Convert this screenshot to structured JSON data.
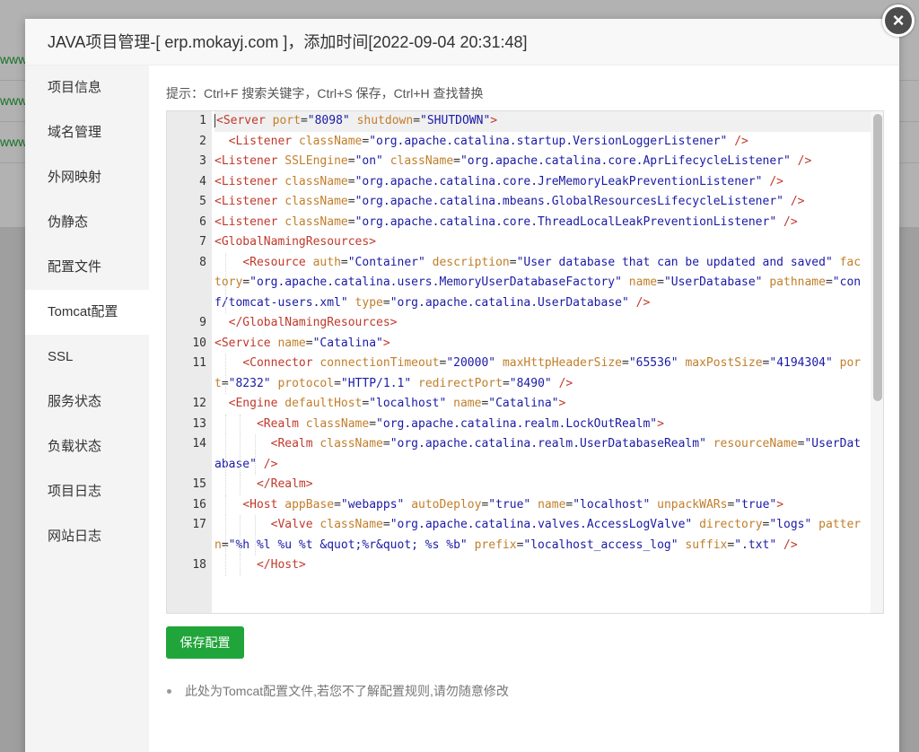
{
  "background": {
    "links": [
      "www",
      "www",
      "www"
    ]
  },
  "dialog": {
    "title": "JAVA项目管理-[ erp.mokayj.com ]，添加时间[2022-09-04 20:31:48]",
    "close_glyph": "×"
  },
  "sidebar": {
    "items": [
      {
        "label": "项目信息",
        "active": false
      },
      {
        "label": "域名管理",
        "active": false
      },
      {
        "label": "外网映射",
        "active": false
      },
      {
        "label": "伪静态",
        "active": false
      },
      {
        "label": "配置文件",
        "active": false
      },
      {
        "label": "Tomcat配置",
        "active": true
      },
      {
        "label": "SSL",
        "active": false
      },
      {
        "label": "服务状态",
        "active": false
      },
      {
        "label": "负载状态",
        "active": false
      },
      {
        "label": "项目日志",
        "active": false
      },
      {
        "label": "网站日志",
        "active": false
      }
    ]
  },
  "main": {
    "hint": "提示：Ctrl+F 搜索关键字，Ctrl+S 保存，Ctrl+H 查找替换",
    "save_label": "保存配置",
    "notes": [
      "此处为Tomcat配置文件,若您不了解配置规则,请勿随意修改"
    ]
  },
  "editor": {
    "active_line": 1,
    "lines": [
      {
        "n": "1",
        "indent": "",
        "guides": 0,
        "tokens": [
          [
            "tag",
            "<Server"
          ],
          [
            "t",
            " "
          ],
          [
            "attr",
            "port"
          ],
          [
            "t",
            "="
          ],
          [
            "val",
            "\"8098\""
          ],
          [
            "t",
            " "
          ],
          [
            "attr",
            "shutdown"
          ],
          [
            "t",
            "="
          ],
          [
            "val",
            "\"SHUTDOWN\""
          ],
          [
            "tag",
            ">"
          ]
        ]
      },
      {
        "n": "2",
        "indent": "  ",
        "guides": 0,
        "tokens": [
          [
            "tag",
            "<Listener"
          ],
          [
            "t",
            " "
          ],
          [
            "attr",
            "className"
          ],
          [
            "t",
            "="
          ],
          [
            "val",
            "\"org.apache.catalina.startup.VersionLoggerListener\""
          ],
          [
            "t",
            " "
          ],
          [
            "tag",
            "/>"
          ]
        ]
      },
      {
        "n": "3",
        "indent": "",
        "guides": 0,
        "tokens": [
          [
            "tag",
            "<Listener"
          ],
          [
            "t",
            " "
          ],
          [
            "attr",
            "SSLEngine"
          ],
          [
            "t",
            "="
          ],
          [
            "val",
            "\"on\""
          ],
          [
            "t",
            " "
          ],
          [
            "attr",
            "className"
          ],
          [
            "t",
            "="
          ],
          [
            "val",
            "\"org.apache.catalina.core.AprLifecycleListener\""
          ],
          [
            "t",
            " "
          ],
          [
            "tag",
            "/>"
          ]
        ]
      },
      {
        "n": "4",
        "indent": "",
        "guides": 0,
        "tokens": [
          [
            "tag",
            "<Listener"
          ],
          [
            "t",
            " "
          ],
          [
            "attr",
            "className"
          ],
          [
            "t",
            "="
          ],
          [
            "val",
            "\"org.apache.catalina.core.JreMemoryLeakPreventionListener\""
          ],
          [
            "t",
            " "
          ],
          [
            "tag",
            "/>"
          ]
        ]
      },
      {
        "n": "5",
        "indent": "",
        "guides": 0,
        "tokens": [
          [
            "tag",
            "<Listener"
          ],
          [
            "t",
            " "
          ],
          [
            "attr",
            "className"
          ],
          [
            "t",
            "="
          ],
          [
            "val",
            "\"org.apache.catalina.mbeans.GlobalResourcesLifecycleListener\""
          ],
          [
            "t",
            " "
          ],
          [
            "tag",
            "/>"
          ]
        ]
      },
      {
        "n": "6",
        "indent": "",
        "guides": 0,
        "tokens": [
          [
            "tag",
            "<Listener"
          ],
          [
            "t",
            " "
          ],
          [
            "attr",
            "className"
          ],
          [
            "t",
            "="
          ],
          [
            "val",
            "\"org.apache.catalina.core.ThreadLocalLeakPreventionListener\""
          ],
          [
            "t",
            " "
          ],
          [
            "tag",
            "/>"
          ]
        ]
      },
      {
        "n": "7",
        "indent": "",
        "guides": 0,
        "tokens": [
          [
            "tag",
            "<GlobalNamingResources>"
          ]
        ]
      },
      {
        "n": "8",
        "indent": "    ",
        "guides": 1,
        "tokens": [
          [
            "tag",
            "<Resource"
          ],
          [
            "t",
            " "
          ],
          [
            "attr",
            "auth"
          ],
          [
            "t",
            "="
          ],
          [
            "val",
            "\"Container\""
          ],
          [
            "t",
            " "
          ],
          [
            "attr",
            "description"
          ],
          [
            "t",
            "="
          ],
          [
            "val",
            "\"User database that can be updated and saved\""
          ],
          [
            "t",
            " "
          ],
          [
            "attr",
            "factory"
          ],
          [
            "t",
            "="
          ],
          [
            "val",
            "\"org.apache.catalina.users.MemoryUserDatabaseFactory\""
          ],
          [
            "t",
            " "
          ],
          [
            "attr",
            "name"
          ],
          [
            "t",
            "="
          ],
          [
            "val",
            "\"UserDatabase\""
          ],
          [
            "t",
            " "
          ],
          [
            "attr",
            "pathname"
          ],
          [
            "t",
            "="
          ],
          [
            "val",
            "\"conf/tomcat-users.xml\""
          ],
          [
            "t",
            " "
          ],
          [
            "attr",
            "type"
          ],
          [
            "t",
            "="
          ],
          [
            "val",
            "\"org.apache.catalina.UserDatabase\""
          ],
          [
            "t",
            " "
          ],
          [
            "tag",
            "/>"
          ]
        ]
      },
      {
        "n": "9",
        "indent": "  ",
        "guides": 0,
        "tokens": [
          [
            "tag",
            "</GlobalNamingResources>"
          ]
        ]
      },
      {
        "n": "10",
        "indent": "",
        "guides": 0,
        "tokens": [
          [
            "tag",
            "<Service"
          ],
          [
            "t",
            " "
          ],
          [
            "attr",
            "name"
          ],
          [
            "t",
            "="
          ],
          [
            "val",
            "\"Catalina\""
          ],
          [
            "tag",
            ">"
          ]
        ]
      },
      {
        "n": "11",
        "indent": "    ",
        "guides": 1,
        "tokens": [
          [
            "tag",
            "<Connector"
          ],
          [
            "t",
            " "
          ],
          [
            "attr",
            "connectionTimeout"
          ],
          [
            "t",
            "="
          ],
          [
            "val",
            "\"20000\""
          ],
          [
            "t",
            " "
          ],
          [
            "attr",
            "maxHttpHeaderSize"
          ],
          [
            "t",
            "="
          ],
          [
            "val",
            "\"65536\""
          ],
          [
            "t",
            " "
          ],
          [
            "attr",
            "maxPostSize"
          ],
          [
            "t",
            "="
          ],
          [
            "val",
            "\"4194304\""
          ],
          [
            "t",
            " "
          ],
          [
            "attr",
            "port"
          ],
          [
            "t",
            "="
          ],
          [
            "val",
            "\"8232\""
          ],
          [
            "t",
            " "
          ],
          [
            "attr",
            "protocol"
          ],
          [
            "t",
            "="
          ],
          [
            "val",
            "\"HTTP/1.1\""
          ],
          [
            "t",
            " "
          ],
          [
            "attr",
            "redirectPort"
          ],
          [
            "t",
            "="
          ],
          [
            "val",
            "\"8490\""
          ],
          [
            "t",
            " "
          ],
          [
            "tag",
            "/>"
          ]
        ]
      },
      {
        "n": "12",
        "indent": "  ",
        "guides": 0,
        "tokens": [
          [
            "tag",
            "<Engine"
          ],
          [
            "t",
            " "
          ],
          [
            "attr",
            "defaultHost"
          ],
          [
            "t",
            "="
          ],
          [
            "val",
            "\"localhost\""
          ],
          [
            "t",
            " "
          ],
          [
            "attr",
            "name"
          ],
          [
            "t",
            "="
          ],
          [
            "val",
            "\"Catalina\""
          ],
          [
            "tag",
            ">"
          ]
        ]
      },
      {
        "n": "13",
        "indent": "      ",
        "guides": 2,
        "tokens": [
          [
            "tag",
            "<Realm"
          ],
          [
            "t",
            " "
          ],
          [
            "attr",
            "className"
          ],
          [
            "t",
            "="
          ],
          [
            "val",
            "\"org.apache.catalina.realm.LockOutRealm\""
          ],
          [
            "tag",
            ">"
          ]
        ]
      },
      {
        "n": "14",
        "indent": "        ",
        "guides": 3,
        "tokens": [
          [
            "tag",
            "<Realm"
          ],
          [
            "t",
            " "
          ],
          [
            "attr",
            "className"
          ],
          [
            "t",
            "="
          ],
          [
            "val",
            "\"org.apache.catalina.realm.UserDatabaseRealm\""
          ],
          [
            "t",
            " "
          ],
          [
            "attr",
            "resourceName"
          ],
          [
            "t",
            "="
          ],
          [
            "val",
            "\"UserDatabase\""
          ],
          [
            "t",
            " "
          ],
          [
            "tag",
            "/>"
          ]
        ]
      },
      {
        "n": "15",
        "indent": "      ",
        "guides": 2,
        "tokens": [
          [
            "tag",
            "</Realm>"
          ]
        ]
      },
      {
        "n": "16",
        "indent": "    ",
        "guides": 1,
        "tokens": [
          [
            "tag",
            "<Host"
          ],
          [
            "t",
            " "
          ],
          [
            "attr",
            "appBase"
          ],
          [
            "t",
            "="
          ],
          [
            "val",
            "\"webapps\""
          ],
          [
            "t",
            " "
          ],
          [
            "attr",
            "autoDeploy"
          ],
          [
            "t",
            "="
          ],
          [
            "val",
            "\"true\""
          ],
          [
            "t",
            " "
          ],
          [
            "attr",
            "name"
          ],
          [
            "t",
            "="
          ],
          [
            "val",
            "\"localhost\""
          ],
          [
            "t",
            " "
          ],
          [
            "attr",
            "unpackWARs"
          ],
          [
            "t",
            "="
          ],
          [
            "val",
            "\"true\""
          ],
          [
            "tag",
            ">"
          ]
        ]
      },
      {
        "n": "17",
        "indent": "        ",
        "guides": 3,
        "tokens": [
          [
            "tag",
            "<Valve"
          ],
          [
            "t",
            " "
          ],
          [
            "attr",
            "className"
          ],
          [
            "t",
            "="
          ],
          [
            "val",
            "\"org.apache.catalina.valves.AccessLogValve\""
          ],
          [
            "t",
            " "
          ],
          [
            "attr",
            "directory"
          ],
          [
            "t",
            "="
          ],
          [
            "val",
            "\"logs\""
          ],
          [
            "t",
            " "
          ],
          [
            "attr",
            "pattern"
          ],
          [
            "t",
            "="
          ],
          [
            "val",
            "\"%h %l %u %t &quot;%r&quot; %s %b\""
          ],
          [
            "t",
            " "
          ],
          [
            "attr",
            "prefix"
          ],
          [
            "t",
            "="
          ],
          [
            "val",
            "\"localhost_access_log\""
          ],
          [
            "t",
            " "
          ],
          [
            "attr",
            "suffix"
          ],
          [
            "t",
            "="
          ],
          [
            "val",
            "\".txt\""
          ],
          [
            "t",
            " "
          ],
          [
            "tag",
            "/>"
          ]
        ]
      },
      {
        "n": "18",
        "indent": "      ",
        "guides": 2,
        "tokens": [
          [
            "tag",
            "</Host>"
          ]
        ]
      }
    ]
  }
}
